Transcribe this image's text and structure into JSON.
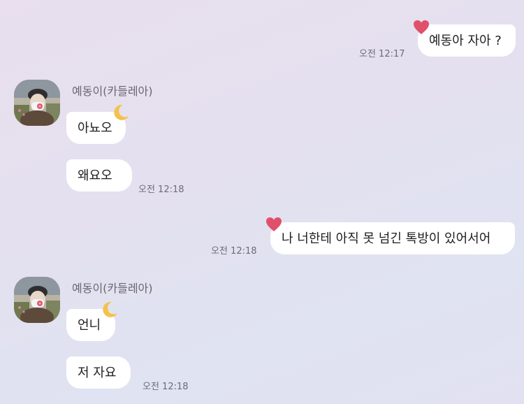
{
  "contact": {
    "name": "예동이(카들레아)"
  },
  "messages": [
    {
      "id": "m1",
      "side": "outgoing",
      "text": "예동아 자아 ?",
      "time": "오전 12:17",
      "sticker": "heart-icon"
    },
    {
      "id": "m2",
      "side": "incoming",
      "text": "아뇨오",
      "sticker": "crescent-moon-icon"
    },
    {
      "id": "m3",
      "side": "incoming",
      "text": "왜요오",
      "time": "오전 12:18"
    },
    {
      "id": "m4",
      "side": "outgoing",
      "text": "나 너한테 아직 못 넘긴 톡방이 있어서어",
      "time": "오전 12:18",
      "sticker": "heart-icon"
    },
    {
      "id": "m5",
      "side": "incoming",
      "text": "언니",
      "sticker": "crescent-moon-icon"
    },
    {
      "id": "m6",
      "side": "incoming",
      "text": "저 자요",
      "time": "오전 12:18"
    }
  ],
  "colors": {
    "heart": "#e0506a",
    "moon": "#f2c24a",
    "bubble": "#ffffff"
  }
}
